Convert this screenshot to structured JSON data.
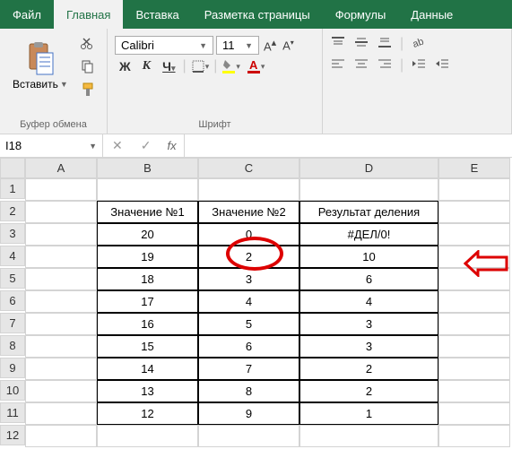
{
  "tabs": {
    "file": "Файл",
    "home": "Главная",
    "insert": "Вставка",
    "layout": "Разметка страницы",
    "formulas": "Формулы",
    "data": "Данные"
  },
  "ribbon": {
    "paste": "Вставить",
    "clipboard_label": "Буфер обмена",
    "font_name": "Calibri",
    "font_size": "11",
    "font_label": "Шрифт",
    "bold": "Ж",
    "italic": "К",
    "underline": "Ч"
  },
  "namebox": "I18",
  "columns": [
    "A",
    "B",
    "C",
    "D",
    "E"
  ],
  "rows": [
    "1",
    "2",
    "3",
    "4",
    "5",
    "6",
    "7",
    "8",
    "9",
    "10",
    "11",
    "12"
  ],
  "table": {
    "headers": {
      "b": "Значение №1",
      "c": "Значение №2",
      "d": "Результат деления"
    },
    "data": [
      {
        "b": "20",
        "c": "0",
        "d": "#ДЕЛ/0!"
      },
      {
        "b": "19",
        "c": "2",
        "d": "10"
      },
      {
        "b": "18",
        "c": "3",
        "d": "6"
      },
      {
        "b": "17",
        "c": "4",
        "d": "4"
      },
      {
        "b": "16",
        "c": "5",
        "d": "3"
      },
      {
        "b": "15",
        "c": "6",
        "d": "3"
      },
      {
        "b": "14",
        "c": "7",
        "d": "2"
      },
      {
        "b": "13",
        "c": "8",
        "d": "2"
      },
      {
        "b": "12",
        "c": "9",
        "d": "1"
      }
    ]
  },
  "chart_data": {
    "type": "table",
    "title": "Результат деления",
    "columns": [
      "Значение №1",
      "Значение №2",
      "Результат деления"
    ],
    "rows": [
      [
        20,
        0,
        "#ДЕЛ/0!"
      ],
      [
        19,
        2,
        10
      ],
      [
        18,
        3,
        6
      ],
      [
        17,
        4,
        4
      ],
      [
        16,
        5,
        3
      ],
      [
        15,
        6,
        3
      ],
      [
        14,
        7,
        2
      ],
      [
        13,
        8,
        2
      ],
      [
        12,
        9,
        1
      ]
    ]
  }
}
